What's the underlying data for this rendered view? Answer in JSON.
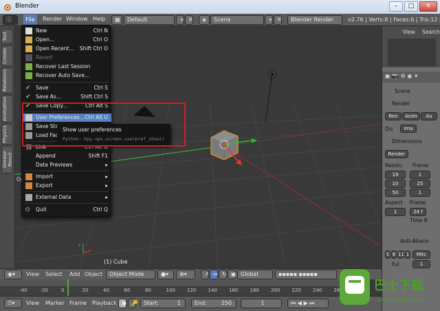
{
  "window": {
    "title": "Blender",
    "min": "–",
    "max": "□",
    "close": "✕"
  },
  "infobar": {
    "menus": [
      "File",
      "Render",
      "Window",
      "Help"
    ],
    "layout": "Default",
    "scene": "Scene",
    "engine": "Blender Render",
    "stats": "v2.76 | Verts:8 | Faces:6 | Tris:12 | Ob"
  },
  "left_tabs": [
    "Tool",
    "Create",
    "Relations",
    "Animation",
    "Physics",
    "Grease Pencil"
  ],
  "file_menu": [
    {
      "label": "New",
      "shortcut": "Ctrl N"
    },
    {
      "label": "Open...",
      "shortcut": "Ctrl O"
    },
    {
      "label": "Open Recent...",
      "shortcut": "Shift Ctrl O",
      "submenu": true
    },
    {
      "label": "Revert",
      "shortcut": "",
      "disabled": true
    },
    {
      "label": "Recover Last Session",
      "shortcut": ""
    },
    {
      "label": "Recover Auto Save...",
      "shortcut": ""
    },
    {
      "label": "Save",
      "shortcut": "Ctrl S"
    },
    {
      "label": "Save As...",
      "shortcut": "Shift Ctrl S"
    },
    {
      "label": "Save Copy...",
      "shortcut": "Ctrl Alt S"
    },
    {
      "label": "User Preferences...",
      "shortcut": "Ctrl Alt U",
      "highlighted": true
    },
    {
      "label": "Save Start",
      "shortcut": ""
    },
    {
      "label": "Load Fact",
      "shortcut": ""
    },
    {
      "label": "Link",
      "shortcut": "Ctrl Alt O"
    },
    {
      "label": "Append",
      "shortcut": "Shift F1"
    },
    {
      "label": "Data Previews",
      "shortcut": "",
      "submenu": true
    },
    {
      "label": "Import",
      "shortcut": "",
      "submenu": true
    },
    {
      "label": "Export",
      "shortcut": "",
      "submenu": true
    },
    {
      "label": "External Data",
      "shortcut": "",
      "submenu": true
    },
    {
      "label": "Quit",
      "shortcut": "Ctrl Q"
    }
  ],
  "tooltip": {
    "title": "Show user preferences",
    "python": "Python: bpy.ops.screen.userpref_show()"
  },
  "viewport": {
    "object_label": "(1) Cube",
    "ops_label": "Op"
  },
  "header3d": {
    "menus": [
      "View",
      "Select",
      "Add",
      "Object"
    ],
    "mode": "Object Mode",
    "orientation": "Global"
  },
  "timeline": {
    "ticks": [
      "-40",
      "-20",
      "0",
      "20",
      "40",
      "60",
      "80",
      "100",
      "120",
      "140",
      "160",
      "180",
      "200",
      "220",
      "240",
      "260"
    ],
    "menus": [
      "View",
      "Marker",
      "Frame",
      "Playback"
    ],
    "start_label": "Start:",
    "start": "1",
    "end_label": "End:",
    "end": "250",
    "current": "1"
  },
  "outliner": {
    "view": "View",
    "search": "Search"
  },
  "properties": {
    "scene": "Scene",
    "render_section": "Render",
    "render_buttons": [
      "Ren",
      "Anim",
      "Au"
    ],
    "display_label": "Dis",
    "display_value": "Ima",
    "dimensions_section": "Dimensions",
    "preset": "Render",
    "resolution_label": "Resolu",
    "frame_label": "Frame",
    "res_x": "19",
    "res_y": "10",
    "res_pct": "50",
    "frame_start": "1",
    "frame_end": "25",
    "frame_step": "1",
    "aspect_label": "Aspect",
    "frame2_label": "Frame",
    "aspect_x": "1",
    "fps": "24 f",
    "time_r": "Time R",
    "aa_section": "Anti-Aliasin",
    "aa_values": [
      "5",
      "8",
      "11",
      "1"
    ],
    "aa_filter": "Mitc",
    "full_label": "Ful",
    "aa_size": "1"
  },
  "watermark": {
    "brand": "巴士下载",
    "url": "www.11684.com"
  }
}
